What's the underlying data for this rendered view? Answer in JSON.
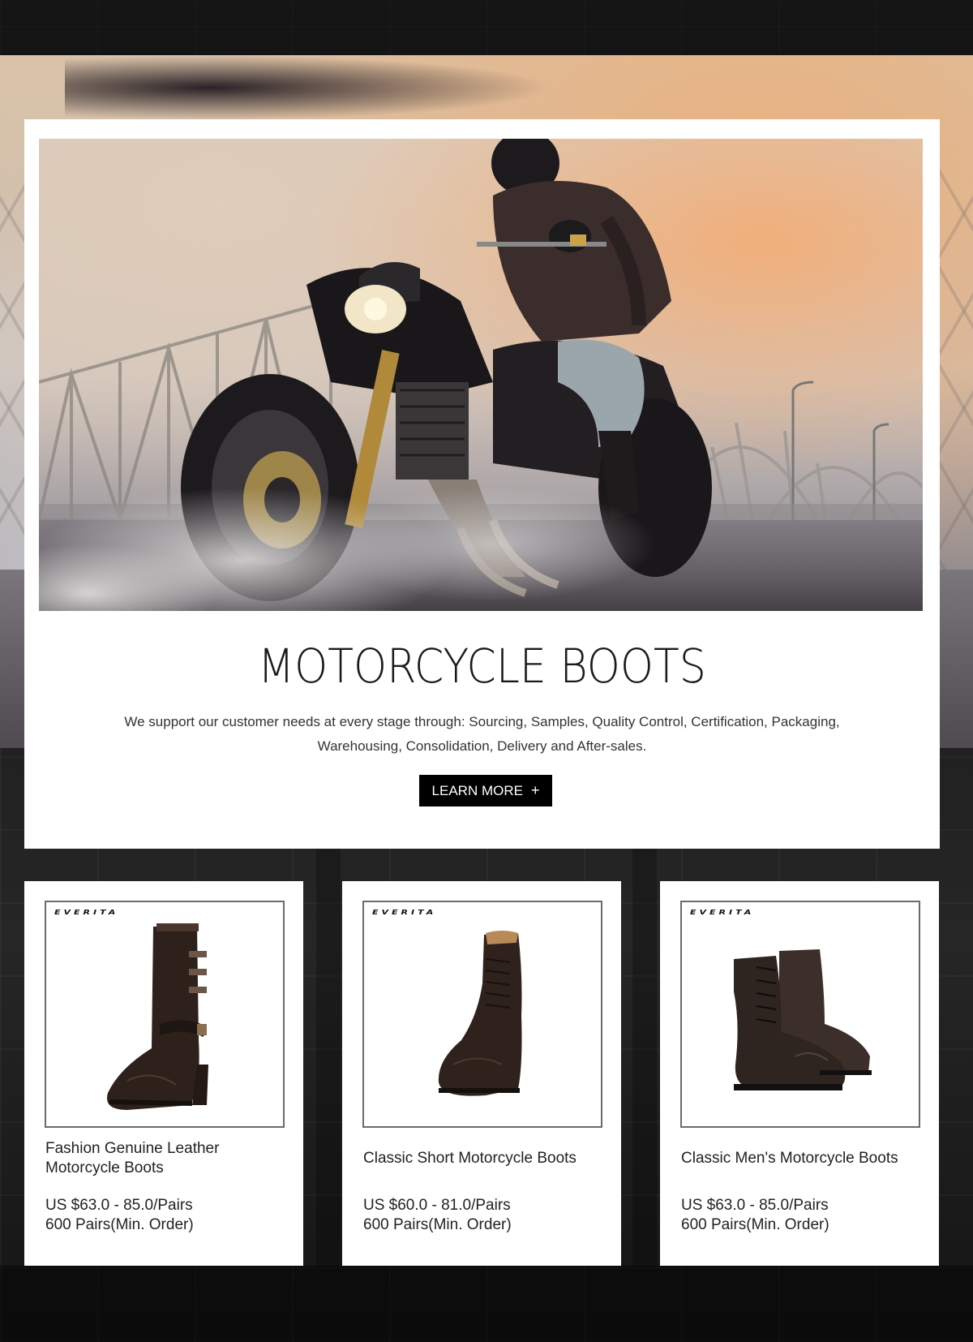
{
  "hero": {
    "title": "MOTORCYCLE BOOTS",
    "description": "We support our customer needs at every stage through: Sourcing, Samples, Quality Control, Certification, Packaging, Warehousing, Consolidation, Delivery and After-sales.",
    "cta_label": "LEARN MORE",
    "cta_icon": "plus-icon",
    "cta_icon_glyph": "+"
  },
  "products": [
    {
      "brand": "EVERITA",
      "name": "Fashion Genuine Leather Motorcycle Boots",
      "price": "US $63.0 - 85.0/Pairs",
      "moq": "600 Pairs(Min. Order)"
    },
    {
      "brand": "EVERITA",
      "name": "Classic Short Motorcycle Boots",
      "price": "US $60.0 - 81.0/Pairs",
      "moq": "600 Pairs(Min. Order)"
    },
    {
      "brand": "EVERITA",
      "name": "Classic Men's Motorcycle Boots",
      "price": "US $63.0 - 85.0/Pairs",
      "moq": "600 Pairs(Min. Order)"
    }
  ],
  "colors": {
    "card_bg": "#ffffff",
    "button_bg": "#000000",
    "button_text": "#ffffff",
    "page_bg": "#1e1e1e",
    "boot_leather": "#3a2a22"
  }
}
